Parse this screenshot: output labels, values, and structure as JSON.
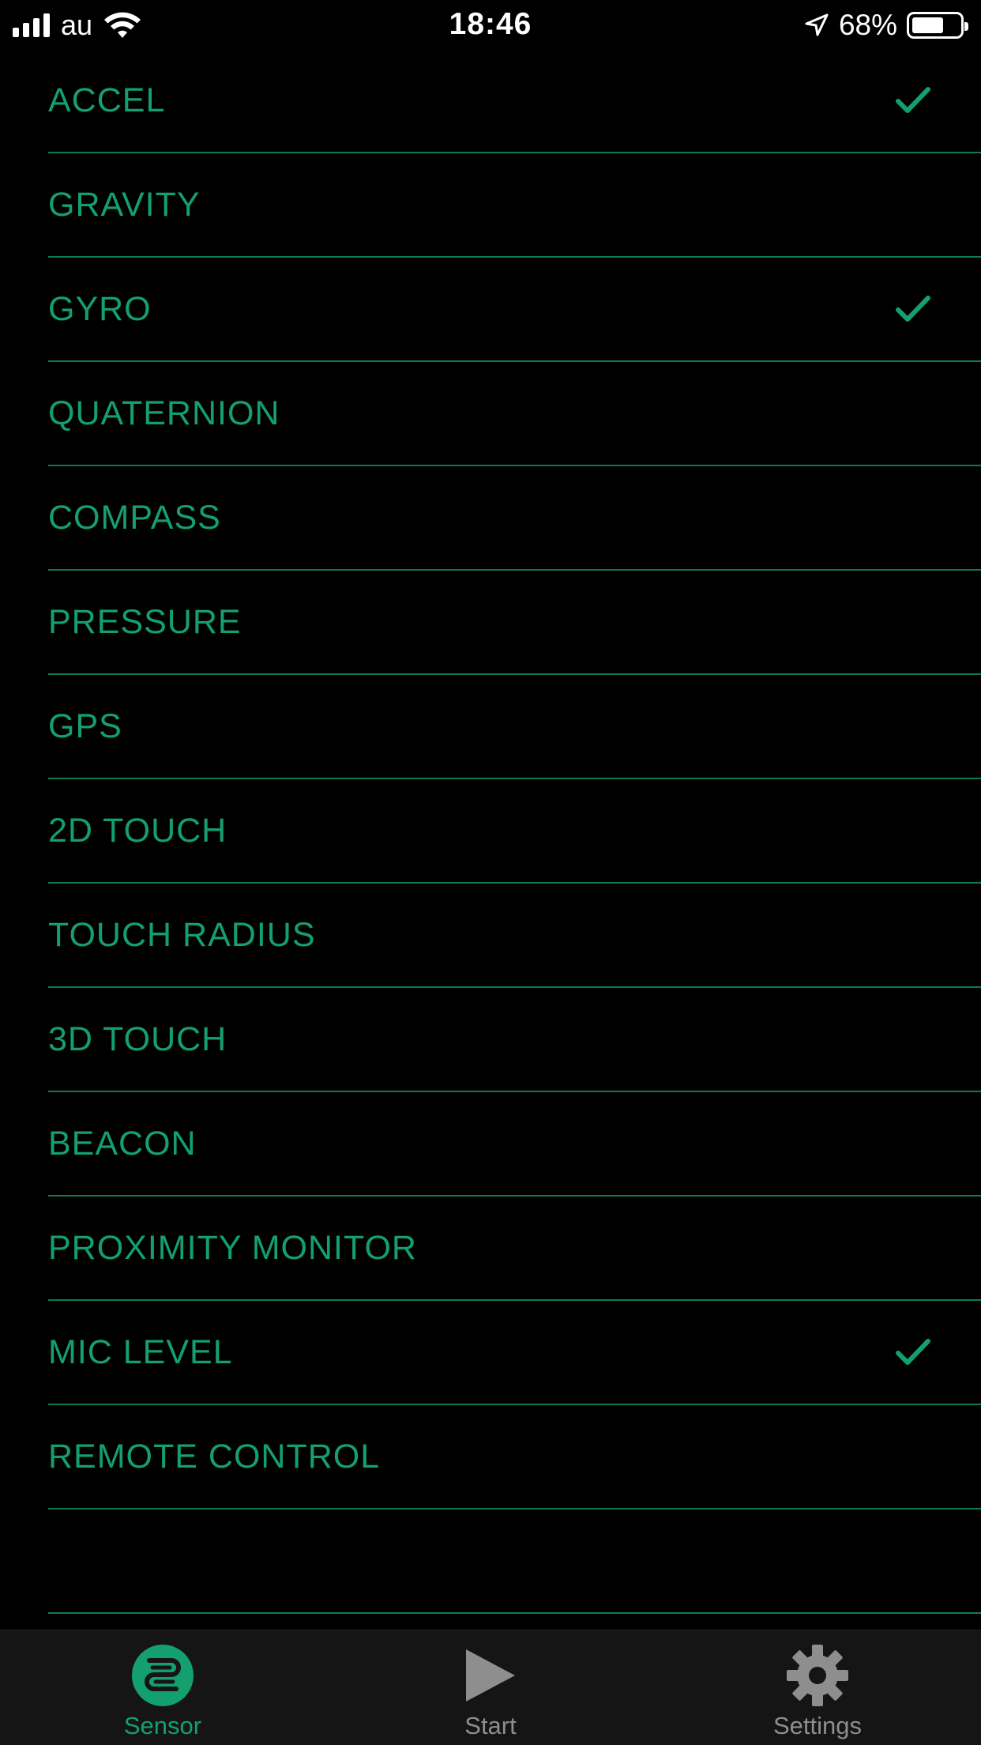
{
  "status_bar": {
    "carrier": "au",
    "time": "18:46",
    "battery_percent": "68%",
    "battery_level": 0.68
  },
  "sensors": [
    {
      "label": "ACCEL",
      "checked": true
    },
    {
      "label": "GRAVITY",
      "checked": false
    },
    {
      "label": "GYRO",
      "checked": true
    },
    {
      "label": "QUATERNION",
      "checked": false
    },
    {
      "label": "COMPASS",
      "checked": false
    },
    {
      "label": "PRESSURE",
      "checked": false
    },
    {
      "label": "GPS",
      "checked": false
    },
    {
      "label": "2D TOUCH",
      "checked": false
    },
    {
      "label": "TOUCH RADIUS",
      "checked": false
    },
    {
      "label": "3D TOUCH",
      "checked": false
    },
    {
      "label": "BEACON",
      "checked": false
    },
    {
      "label": "PROXIMITY MONITOR",
      "checked": false
    },
    {
      "label": "MIC LEVEL",
      "checked": true
    },
    {
      "label": "REMOTE CONTROL",
      "checked": false
    }
  ],
  "tab_bar": {
    "tabs": [
      {
        "label": "Sensor",
        "icon": "sensor-icon",
        "active": true
      },
      {
        "label": "Start",
        "icon": "play-icon",
        "active": false
      },
      {
        "label": "Settings",
        "icon": "gear-icon",
        "active": false
      }
    ]
  },
  "colors": {
    "accent": "#14a06e",
    "divider": "#0f7a52",
    "background": "#000000",
    "tab_bar_background": "#151515",
    "inactive": "#8e8e8e"
  }
}
